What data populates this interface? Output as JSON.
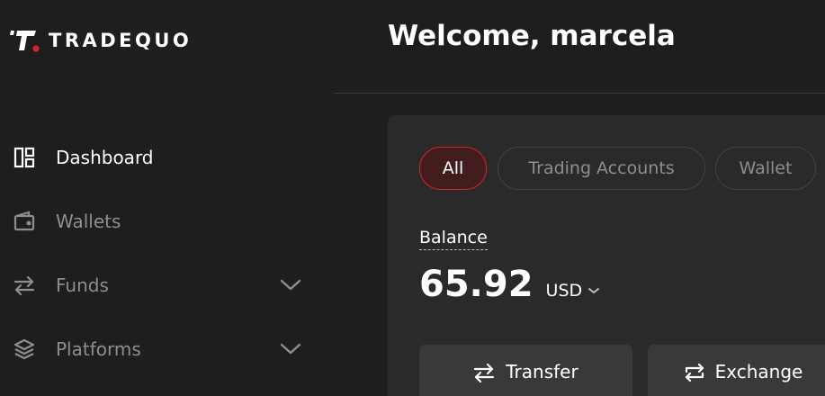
{
  "brand": {
    "name": "TRADEQUO"
  },
  "header": {
    "title": "Welcome, marcela"
  },
  "sidebar": {
    "items": [
      {
        "label": "Dashboard",
        "icon": "dashboard-icon",
        "active": true,
        "expandable": false
      },
      {
        "label": "Wallets",
        "icon": "wallet-icon",
        "active": false,
        "expandable": false
      },
      {
        "label": "Funds",
        "icon": "transfer-arrows-icon",
        "active": false,
        "expandable": true
      },
      {
        "label": "Platforms",
        "icon": "layers-icon",
        "active": false,
        "expandable": true
      }
    ]
  },
  "main": {
    "filters": [
      {
        "label": "All",
        "active": true
      },
      {
        "label": "Trading Accounts",
        "active": false
      },
      {
        "label": "Wallet",
        "active": false
      }
    ],
    "balance": {
      "label": "Balance",
      "amount": "65.92",
      "currency": "USD"
    },
    "actions": {
      "transfer_label": "Transfer",
      "exchange_label": "Exchange"
    }
  },
  "colors": {
    "background": "#1e1e1e",
    "card": "#2b2a2a",
    "accent": "#d5242f",
    "muted_text": "#8e8e8e"
  }
}
